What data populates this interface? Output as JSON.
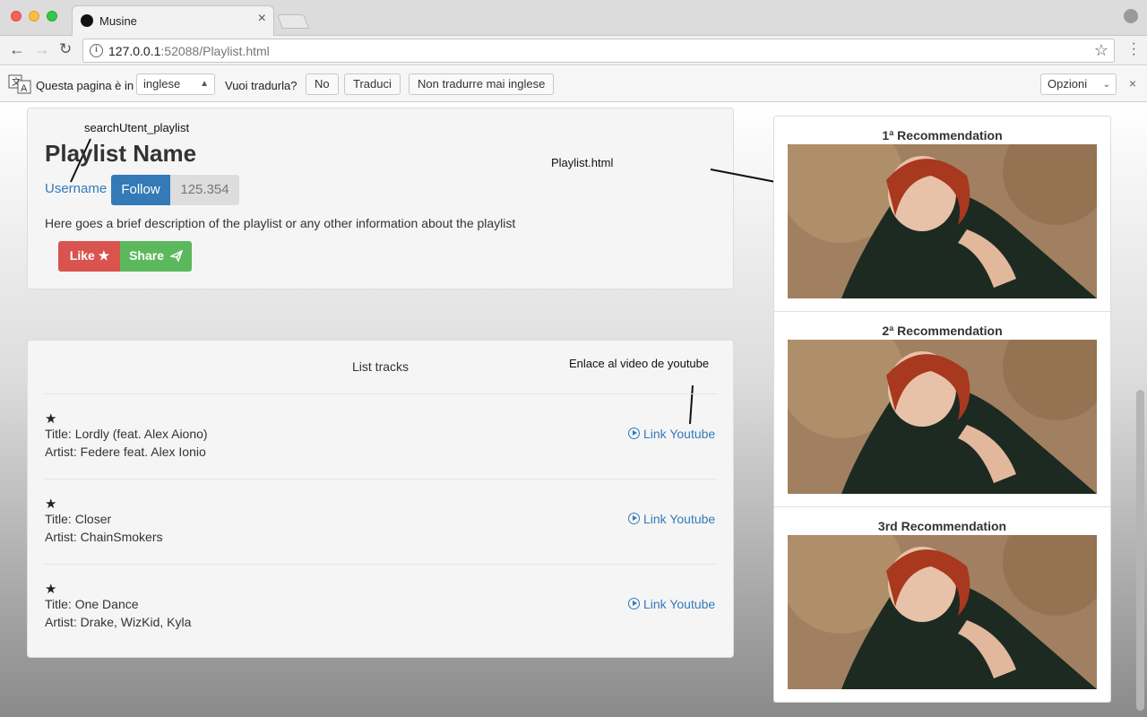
{
  "browser": {
    "tab_title": "Musine",
    "tab_close": "×",
    "url_host": "127.0.0.1",
    "url_rest": ":52088/Playlist.html"
  },
  "translate_bar": {
    "text_prefix": "Questa pagina è in",
    "language": "inglese",
    "question": "Vuoi tradurla?",
    "btn_no": "No",
    "btn_translate": "Traduci",
    "btn_never": "Non tradurre mai inglese",
    "options": "Opzioni",
    "close": "×"
  },
  "annotations": {
    "search": "searchUtent_playlist",
    "page_file": "Playlist.html",
    "youtube_note": "Enlace al video de youtube"
  },
  "playlist": {
    "name": "Playlist Name",
    "username": "Username",
    "follow_label": "Follow",
    "follow_count": "125.354",
    "description": "Here goes a brief description of the playlist or any other information about the playlist",
    "like_label": "Like ★",
    "share_label": "Share"
  },
  "tracks_panel": {
    "title": "List tracks",
    "link_label": "Link Youtube",
    "star": "★",
    "tracks": [
      {
        "title": "Title: Lordly (feat. Alex Aiono)",
        "artist": "Artist: Federe feat. Alex Ionio"
      },
      {
        "title": "Title: Closer",
        "artist": "Artist: ChainSmokers"
      },
      {
        "title": "Title: One Dance",
        "artist": "Artist: Drake, WizKid, Kyla"
      }
    ]
  },
  "recommendations": [
    {
      "title": "1ª Recommendation"
    },
    {
      "title": "2ª Recommendation"
    },
    {
      "title": "3rd Recommendation"
    }
  ]
}
